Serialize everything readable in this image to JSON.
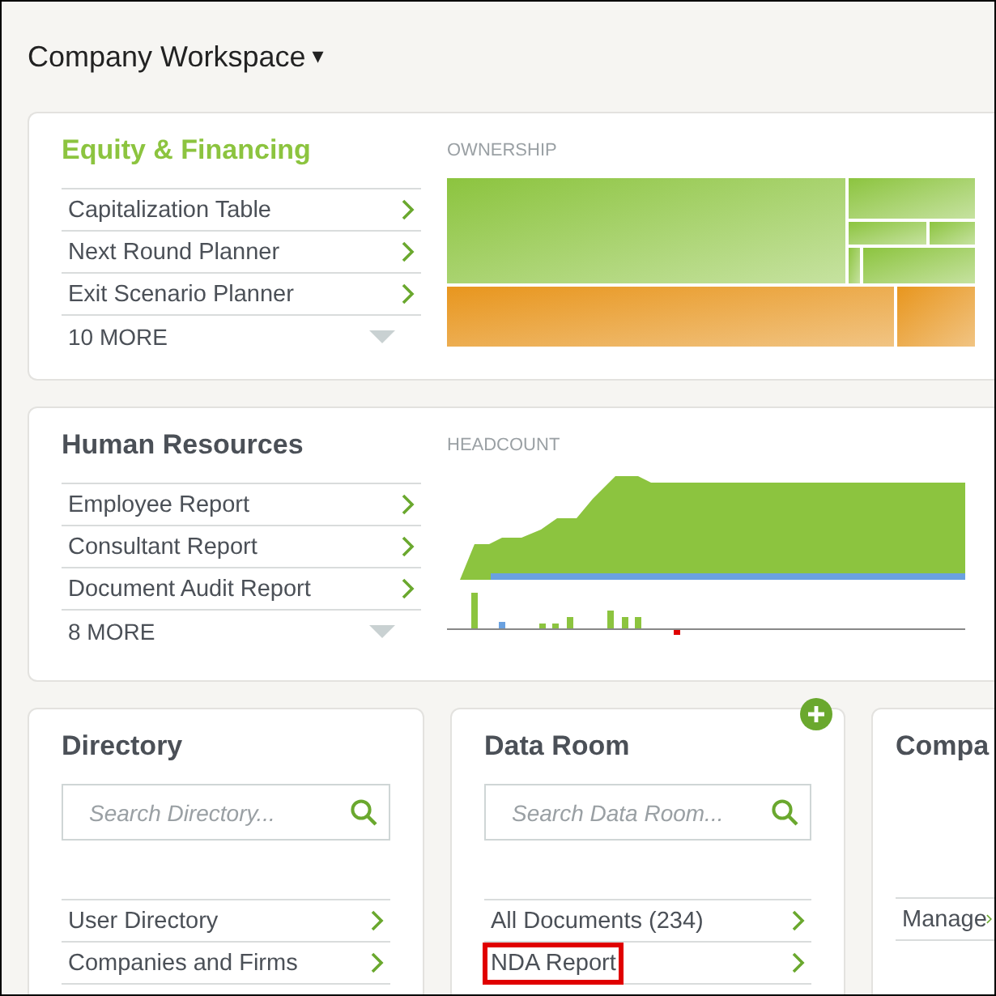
{
  "workspace": {
    "title": "Company Workspace",
    "caret": "▾"
  },
  "equity": {
    "title": "Equity & Financing",
    "chart_label": "OWNERSHIP",
    "items": [
      {
        "label": "Capitalization Table",
        "highlighted": false
      },
      {
        "label": "Next Round Planner",
        "highlighted": false
      },
      {
        "label": "Exit Scenario Planner",
        "highlighted": false
      }
    ],
    "more": "10 MORE"
  },
  "hr": {
    "title": "Human Resources",
    "chart_label": "HEADCOUNT",
    "items": [
      {
        "label": "Employee Report",
        "highlighted": false
      },
      {
        "label": "Consultant Report",
        "highlighted": false
      },
      {
        "label": "Document Audit Report",
        "highlighted": false
      }
    ],
    "more": "8 MORE"
  },
  "cards": [
    {
      "title": "Directory",
      "search": {
        "placeholder": "Search Directory..."
      },
      "add_button": false,
      "items": [
        {
          "label": "User Directory",
          "highlighted": false
        },
        {
          "label": "Companies and Firms",
          "highlighted": false
        }
      ]
    },
    {
      "title": "Data Room",
      "search": {
        "placeholder": "Search Data Room..."
      },
      "add_button": true,
      "items": [
        {
          "label": "All Documents (234)",
          "highlighted": false
        },
        {
          "label": "NDA Report",
          "highlighted": true
        }
      ]
    },
    {
      "title": "Compa",
      "add_button": false,
      "items": [
        {
          "label": "Manage",
          "highlighted": false
        }
      ]
    }
  ]
}
